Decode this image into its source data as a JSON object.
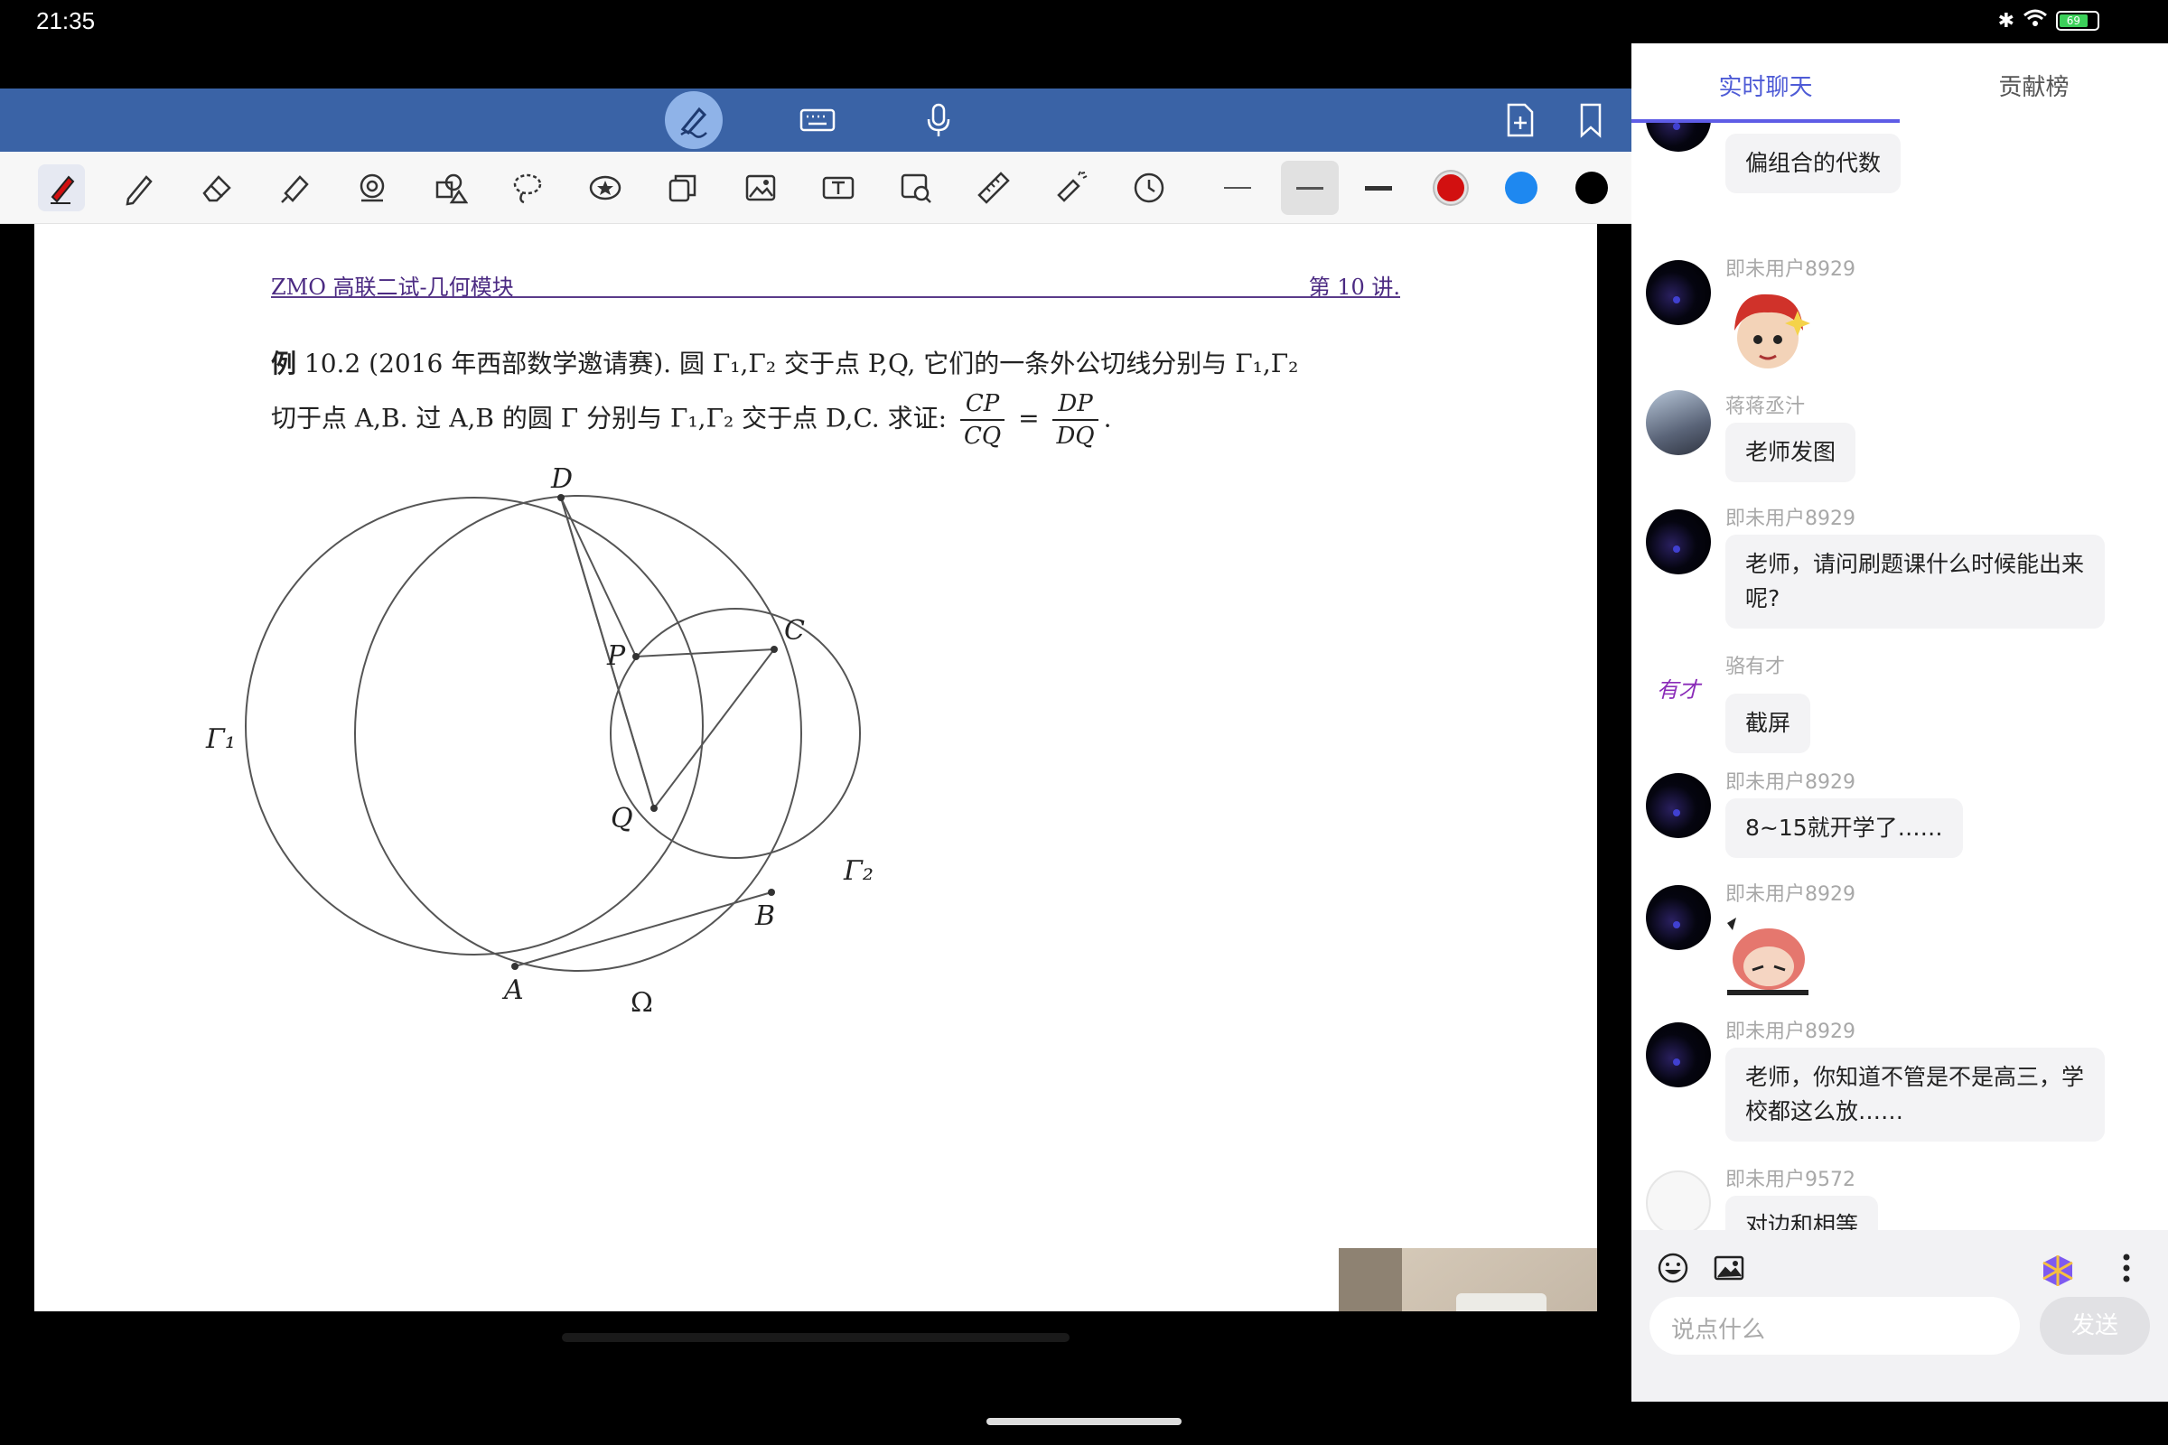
{
  "status": {
    "time": "21:35",
    "battery": "69"
  },
  "document": {
    "header_left": "ZMO 高联二试-几何模块",
    "header_right": "第 10 讲.",
    "problem_label": "例",
    "problem_line1": " 10.2 (2016 年西部数学邀请赛). 圆 Γ₁,Γ₂ 交于点 P,Q, 它们的一条外公切线分别与 Γ₁,Γ₂",
    "problem_line2": "切于点 A,B. 过 A,B 的圆 Γ 分别与 Γ₁,Γ₂ 交于点 D,C. 求证:",
    "frac1_num": "CP",
    "frac1_den": "CQ",
    "eq": "=",
    "frac2_num": "DP",
    "frac2_den": "DQ",
    "end": ".",
    "labels": {
      "D": "D",
      "P": "P",
      "C": "C",
      "Q": "Q",
      "B": "B",
      "A": "A",
      "G1": "Γ₁",
      "G2": "Γ₂",
      "Omega": "Ω"
    }
  },
  "tools": [
    "pen-active",
    "pencil",
    "eraser",
    "highlighter",
    "shape",
    "geometry",
    "lasso",
    "sticker",
    "layers",
    "image",
    "text",
    "search-image",
    "ruler",
    "laser",
    "timer"
  ],
  "colors": {
    "red": "#d21010",
    "blue": "#1e88f0",
    "black": "#000000",
    "topbar": "#3a63a6",
    "accent": "#5e5ce6"
  },
  "chat": {
    "tabs": [
      "实时聊天",
      "贡献榜"
    ],
    "messages": [
      {
        "user": "",
        "text": "偏组合的代数",
        "avatar": "dark"
      },
      {
        "user": "即未用户8929",
        "text": "",
        "sticker": true,
        "avatar": "dark"
      },
      {
        "user": "蒋蒋丞汁",
        "text": "老师发图",
        "avatar": "photo"
      },
      {
        "user": "即未用户8929",
        "text": "老师，请问刷题课什么时候能出来呢?",
        "avatar": "dark"
      },
      {
        "user": "骆有才",
        "text": "截屏",
        "avatar": "sig",
        "avatar_text": "有才"
      },
      {
        "user": "即未用户8929",
        "text": "8~15就开学了……",
        "avatar": "dark"
      },
      {
        "user": "即未用户8929",
        "text": "",
        "sticker": true,
        "avatar": "dark"
      },
      {
        "user": "即未用户8929",
        "text": "老师，你知道不管是不是高三，学校都这么放……",
        "avatar": "dark"
      },
      {
        "user": "即未用户9572",
        "text": "对边和相等",
        "avatar": "white"
      }
    ],
    "input_placeholder": "说点什么",
    "send_label": "发送"
  }
}
